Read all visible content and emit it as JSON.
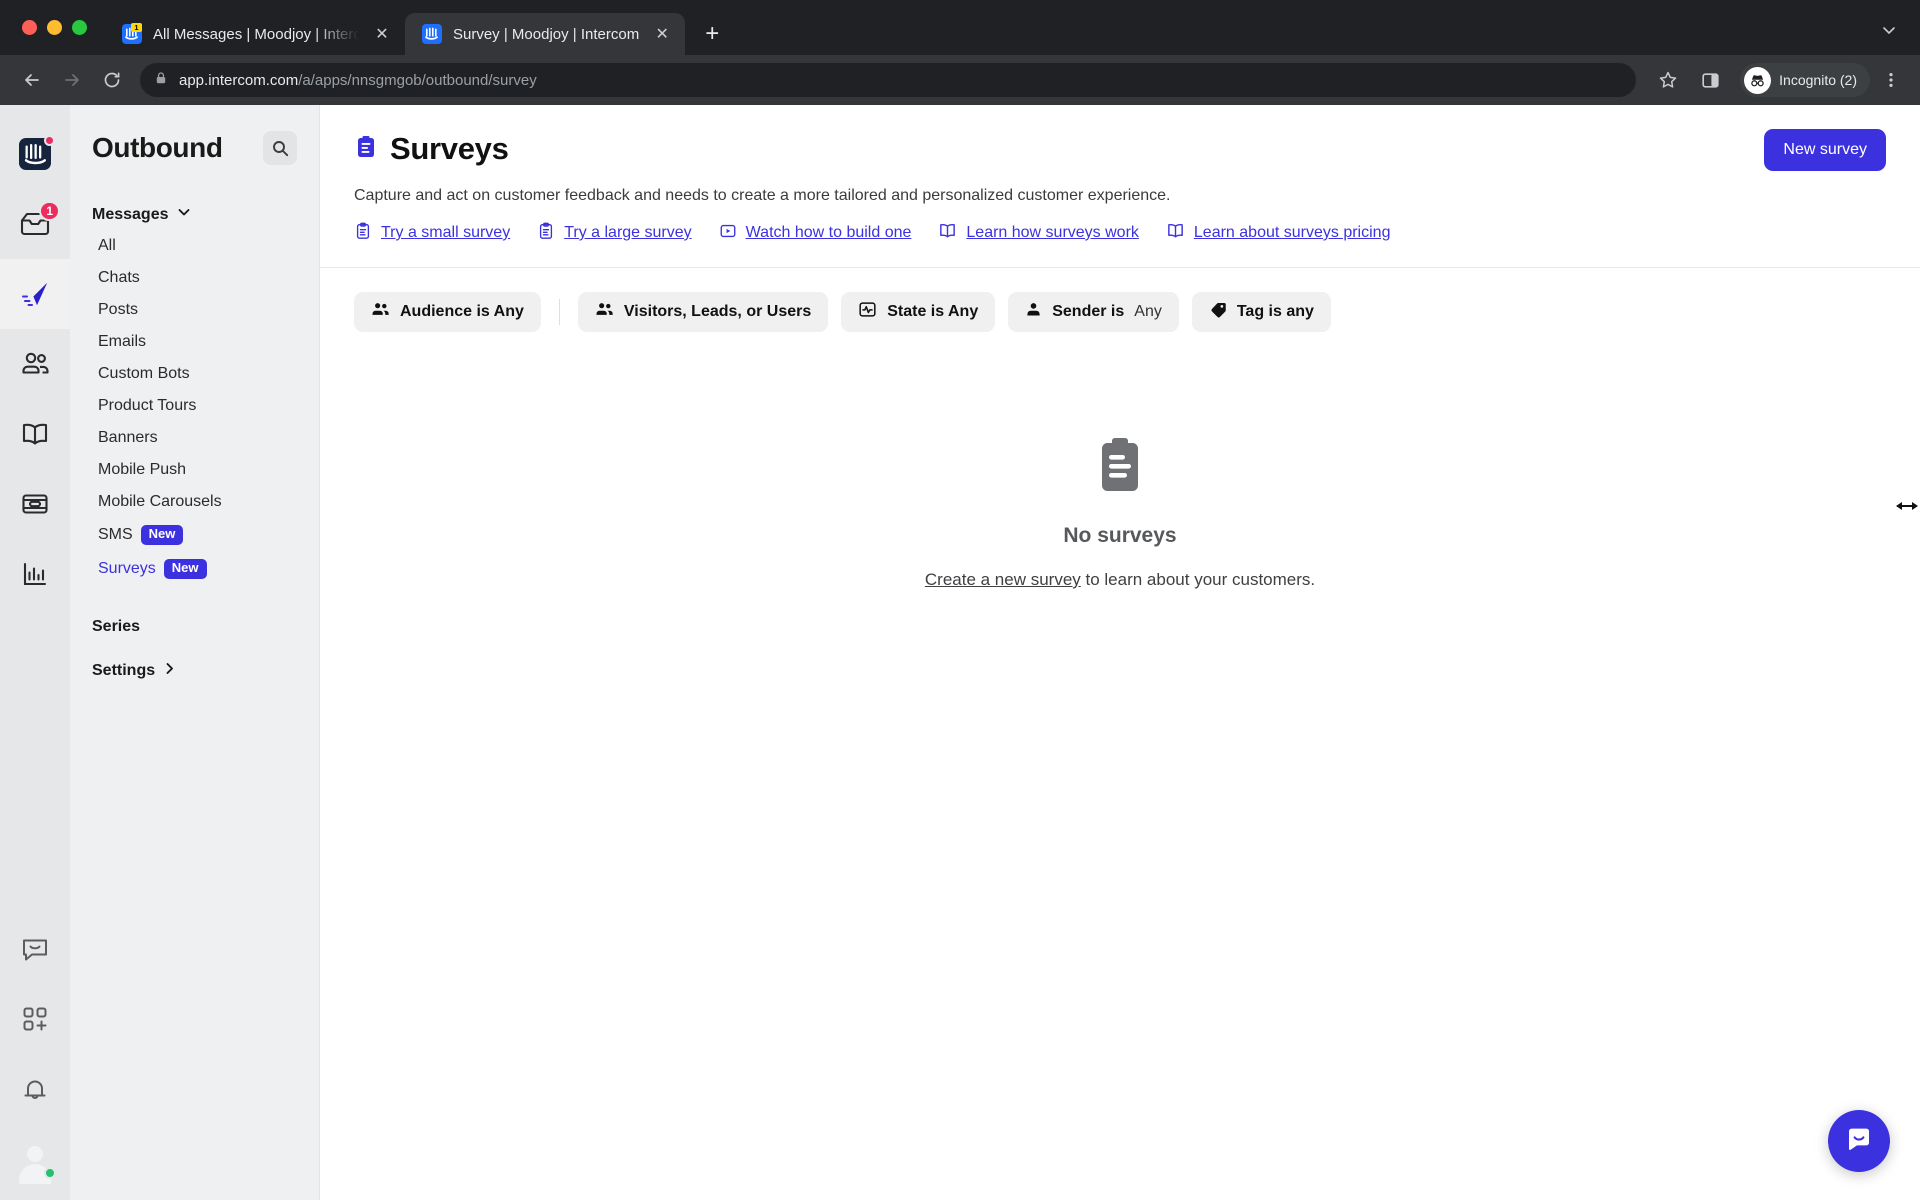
{
  "browser": {
    "tabs": [
      {
        "title": "All Messages | Moodjoy | Intercom",
        "active": false,
        "favicon": "intercom-badge-favicon",
        "close_label": "✕"
      },
      {
        "title": "Survey | Moodjoy | Intercom",
        "active": true,
        "favicon": "intercom-favicon",
        "close_label": "✕"
      }
    ],
    "new_tab_label": "+",
    "tablist_chevron": "chevron-down-icon",
    "url_secure_domain": "app.intercom.com",
    "url_path": "/a/apps/nnsgmgob/outbound/survey",
    "profile_label": "Incognito (2)"
  },
  "rail": {
    "items": [
      {
        "name": "intercom-logo",
        "badge": "dot"
      },
      {
        "name": "inbox",
        "badge": "1"
      },
      {
        "name": "outbound",
        "selected": true
      },
      {
        "name": "contacts"
      },
      {
        "name": "articles"
      },
      {
        "name": "tickets"
      },
      {
        "name": "reports"
      }
    ],
    "bottom_items": [
      {
        "name": "messenger"
      },
      {
        "name": "apps"
      },
      {
        "name": "notifications"
      },
      {
        "name": "profile-avatar"
      }
    ]
  },
  "sidebar": {
    "title": "Outbound",
    "search_icon": "search-icon",
    "group": {
      "label": "Messages",
      "chevron": "chevron-down-icon",
      "items": [
        {
          "label": "All"
        },
        {
          "label": "Chats"
        },
        {
          "label": "Posts"
        },
        {
          "label": "Emails"
        },
        {
          "label": "Custom Bots"
        },
        {
          "label": "Product Tours"
        },
        {
          "label": "Banners"
        },
        {
          "label": "Mobile Push"
        },
        {
          "label": "Mobile Carousels"
        },
        {
          "label": "SMS",
          "badge": "New"
        },
        {
          "label": "Surveys",
          "badge": "New",
          "active": true
        }
      ]
    },
    "sections": [
      {
        "label": "Series",
        "chevron": ""
      },
      {
        "label": "Settings",
        "chevron": "chevron-right-icon"
      }
    ]
  },
  "main": {
    "title": "Surveys",
    "title_icon": "clipboard-icon",
    "new_button": "New survey",
    "subtitle": "Capture and act on customer feedback and needs to create a more tailored and personalized customer experience.",
    "quick_links": [
      {
        "label": "Try a small survey",
        "icon": "clipboard-icon"
      },
      {
        "label": "Try a large survey",
        "icon": "clipboard-icon"
      },
      {
        "label": "Watch how to build one",
        "icon": "play-video-icon"
      },
      {
        "label": "Learn how surveys work",
        "icon": "book-icon"
      },
      {
        "label": "Learn about surveys pricing",
        "icon": "book-icon"
      }
    ],
    "filters": [
      {
        "label": "Audience is Any",
        "value": "",
        "icon": "people-icon"
      },
      {
        "label": "Visitors, Leads, or Users",
        "value": "",
        "icon": "people-icon"
      },
      {
        "label": "State is Any",
        "value": "",
        "icon": "pulse-icon"
      },
      {
        "label": "Sender is",
        "value": "Any",
        "icon": "person-icon"
      },
      {
        "label": "Tag is any",
        "value": "",
        "icon": "tag-icon"
      }
    ],
    "empty_state": {
      "icon": "clipboard-icon",
      "title": "No surveys",
      "link_text": "Create a new survey",
      "rest_text": " to learn about your customers."
    },
    "messenger_launcher": "messenger-icon"
  },
  "colors": {
    "accent": "#3c31de",
    "badge_red": "#ed2b5c",
    "presence_green": "#25c16f",
    "chrome_bg": "#202124",
    "toolbar_bg": "#35363a"
  }
}
